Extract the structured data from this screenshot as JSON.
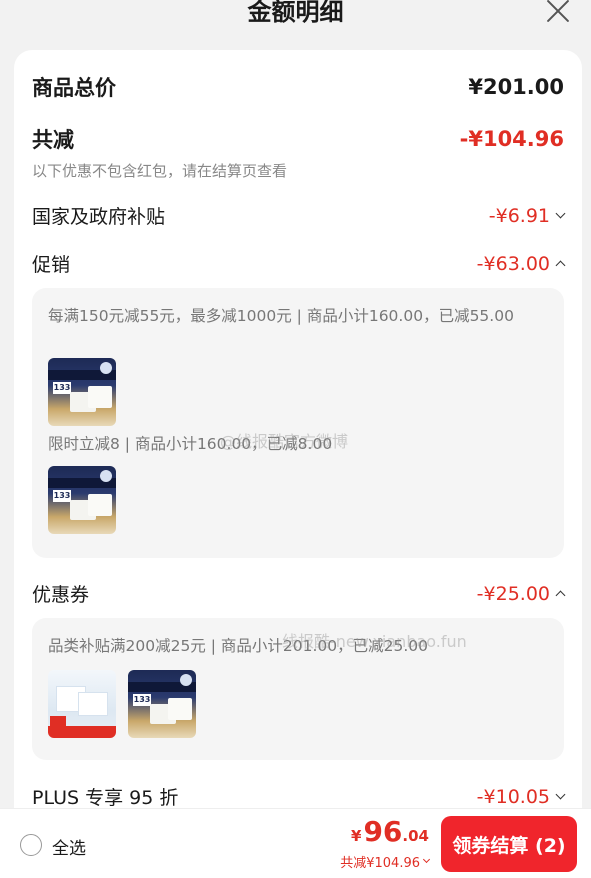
{
  "header": {
    "title": "金额明细"
  },
  "rows": {
    "total_goods": {
      "label": "商品总价",
      "amount": "¥201.00"
    },
    "total_reduce": {
      "label": "共减",
      "amount": "-¥104.96",
      "note": "以下优惠不包含红包，请在结算页查看"
    },
    "gov_subsidy": {
      "label": "国家及政府补贴",
      "amount": "-¥6.91"
    },
    "promotion": {
      "label": "促销",
      "amount": "-¥63.00"
    },
    "coupon": {
      "label": "优惠券",
      "amount": "-¥25.00"
    },
    "plus": {
      "label": "PLUS 专享 95 折",
      "amount": "-¥10.05"
    }
  },
  "promotion_panel": {
    "item1_text": "每满150元减55元，最多减1000元 | 商品小计160.00，已减55.00",
    "item2_text": "限时立减8 | 商品小计160.00，已减8.00"
  },
  "coupon_panel": {
    "item1_text": "品类补贴满200减25元 | 商品小计201.00，已减25.00"
  },
  "thumbs": {
    "dark_badge": "133"
  },
  "watermarks": {
    "w1": "@线报酷官方微博",
    "w2": "线报酷-new.xianbao.fun"
  },
  "footer": {
    "select_all": "全选",
    "currency": "¥",
    "price_int": "96",
    "price_dec": ".04",
    "reduce_text": "共减¥104.96",
    "checkout_label": "领券结算 (2)"
  },
  "colors": {
    "accent": "#e02e24",
    "button": "#f0252c"
  }
}
